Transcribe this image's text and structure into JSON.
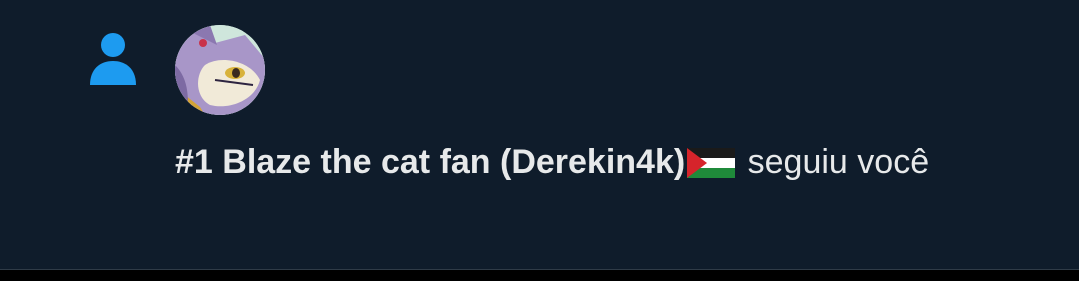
{
  "notification": {
    "icon": "person-follow-icon",
    "avatar_icon": "blaze-the-cat-avatar",
    "user_name": "#1 Blaze the cat fan (Derekin4k)",
    "flag_icon": "palestine-flag-icon",
    "action_text": " seguiu você"
  },
  "colors": {
    "background": "#0f1c2b",
    "accent": "#1d9bf0",
    "text": "#e7e9ea"
  }
}
